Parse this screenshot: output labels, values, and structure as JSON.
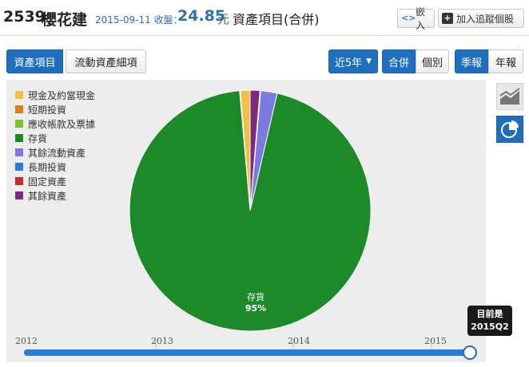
{
  "header": {
    "code": "2539",
    "name": "櫻花建",
    "date_close_label": "2015-09-11 收盤：",
    "price": "24.85",
    "price_unit": "元",
    "title": "資產項目(合併)",
    "embed_label": "嵌入",
    "follow_label": "加入追蹤個股"
  },
  "tabs": [
    {
      "label": "資產項目",
      "active": true
    },
    {
      "label": "流動資產細項",
      "active": false
    }
  ],
  "controls": {
    "range_label": "近5年",
    "consolidated_label": "合併",
    "individual_label": "個別",
    "quarterly_label": "季報",
    "annual_label": "年報"
  },
  "chart_data": {
    "type": "pie",
    "legend": [
      {
        "name": "現金及約當現金",
        "color": "#f0c040"
      },
      {
        "name": "短期投資",
        "color": "#e07820"
      },
      {
        "name": "應收帳款及票據",
        "color": "#80c030"
      },
      {
        "name": "存貨",
        "color": "#1d8a2a"
      },
      {
        "name": "其餘流動資產",
        "color": "#7a7ae0"
      },
      {
        "name": "長期投資",
        "color": "#2a7ad8"
      },
      {
        "name": "固定資產",
        "color": "#c03030"
      },
      {
        "name": "其餘資產",
        "color": "#7a2a80"
      }
    ],
    "slices": [
      {
        "name": "現金及約當現金",
        "value": 1.3,
        "color": "#f0c040"
      },
      {
        "name": "短期投資",
        "value": 0.05,
        "color": "#e07820"
      },
      {
        "name": "應收帳款及票據",
        "value": 0.05,
        "color": "#80c030"
      },
      {
        "name": "存貨",
        "value": 95,
        "color": "#1d8a2a"
      },
      {
        "name": "其餘流動資產",
        "value": 2.2,
        "color": "#7a7ae0"
      },
      {
        "name": "長期投資",
        "value": 0.05,
        "color": "#2a7ad8"
      },
      {
        "name": "固定資產",
        "value": 0.05,
        "color": "#c03030"
      },
      {
        "name": "其餘資產",
        "value": 1.3,
        "color": "#7a2a80"
      }
    ],
    "slice_label": {
      "name": "存貨",
      "value": "95%"
    },
    "timeline": {
      "ticks": [
        "2012",
        "2013",
        "2014",
        "2015"
      ],
      "current_label_line1": "目前是",
      "current_label_line2": "2015Q2",
      "position": 1.0
    }
  }
}
